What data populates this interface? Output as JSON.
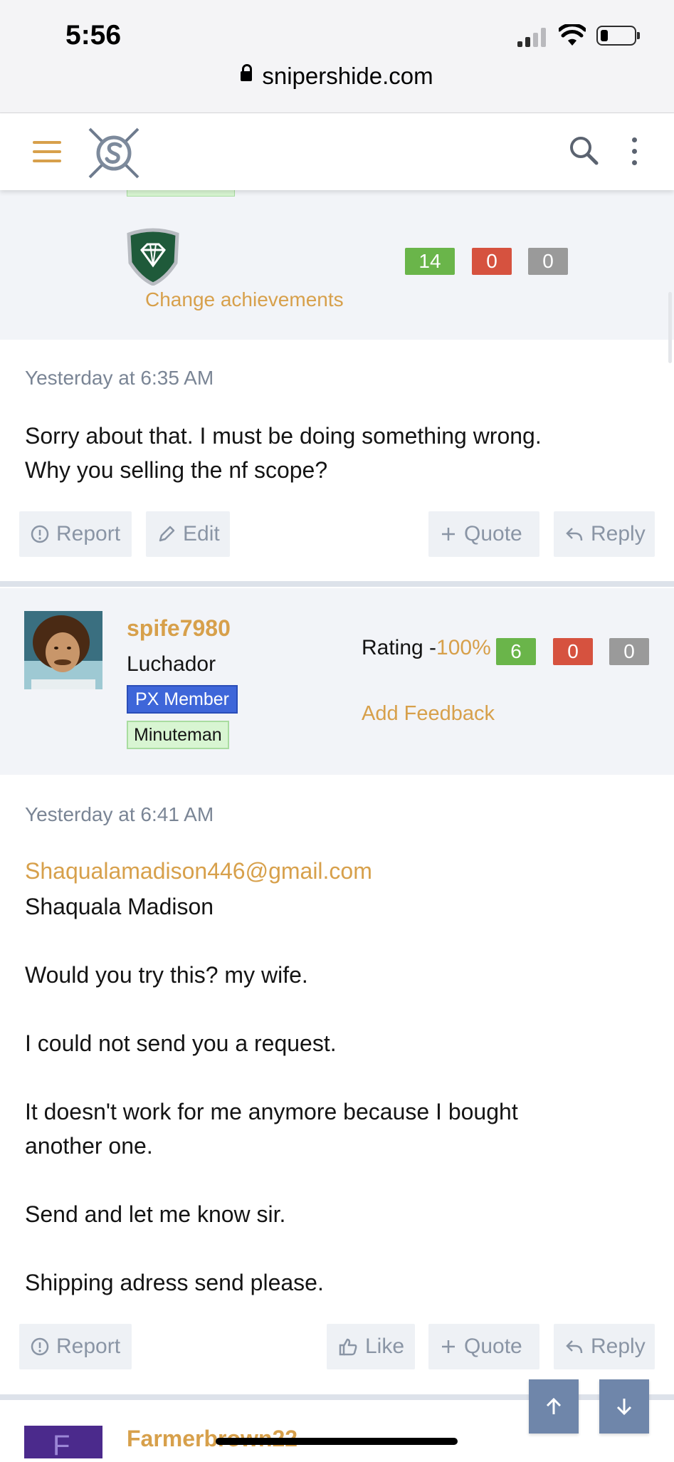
{
  "status_bar": {
    "time": "5:56"
  },
  "browser": {
    "url": "snipershide.com"
  },
  "colors": {
    "accent": "#d7a04b",
    "positive": "#6ab54a",
    "negative": "#d6523f",
    "neutral": "#9a9a9a",
    "px_member": "#3e66d9"
  },
  "header": {
    "menu_icon": "hamburger-icon",
    "search_icon": "search-icon",
    "more_icon": "kebab-icon"
  },
  "profile_top": {
    "achievement_icon": "diamond-badge-icon",
    "change_achievements": "Change achievements",
    "feedback": {
      "positive": "14",
      "negative": "0",
      "neutral": "0"
    }
  },
  "post1": {
    "date": "Yesterday at 6:35 AM",
    "lines": [
      "Sorry about that. I must be doing something wrong.",
      "Why you selling the nf scope?"
    ],
    "actions": {
      "report": "Report",
      "edit": "Edit",
      "quote": "Quote",
      "reply": "Reply"
    }
  },
  "user2": {
    "username": "spife7980",
    "title": "Luchador",
    "badge_px": "PX Member",
    "badge_rank": "Minuteman",
    "rating_label": "Rating -",
    "rating_pct": "100%",
    "feedback": {
      "positive": "6",
      "negative": "0",
      "neutral": "0"
    },
    "add_feedback": "Add Feedback"
  },
  "post2": {
    "date": "Yesterday at 6:41 AM",
    "email": "Shaqualamadison446@gmail.com",
    "name_line": "Shaquala Madison",
    "p1": "Would you try this? my wife.",
    "p2": "I could not send you a request.",
    "p3a": "It doesn't work for me anymore because I bought",
    "p3b": "another one.",
    "p4": "Send and let me know sir.",
    "p5": "Shipping adress send please.",
    "actions": {
      "report": "Report",
      "like": "Like",
      "quote": "Quote",
      "reply": "Reply"
    }
  },
  "next_user": {
    "username": "Farmerbrown22",
    "avatar_letter": "F"
  }
}
